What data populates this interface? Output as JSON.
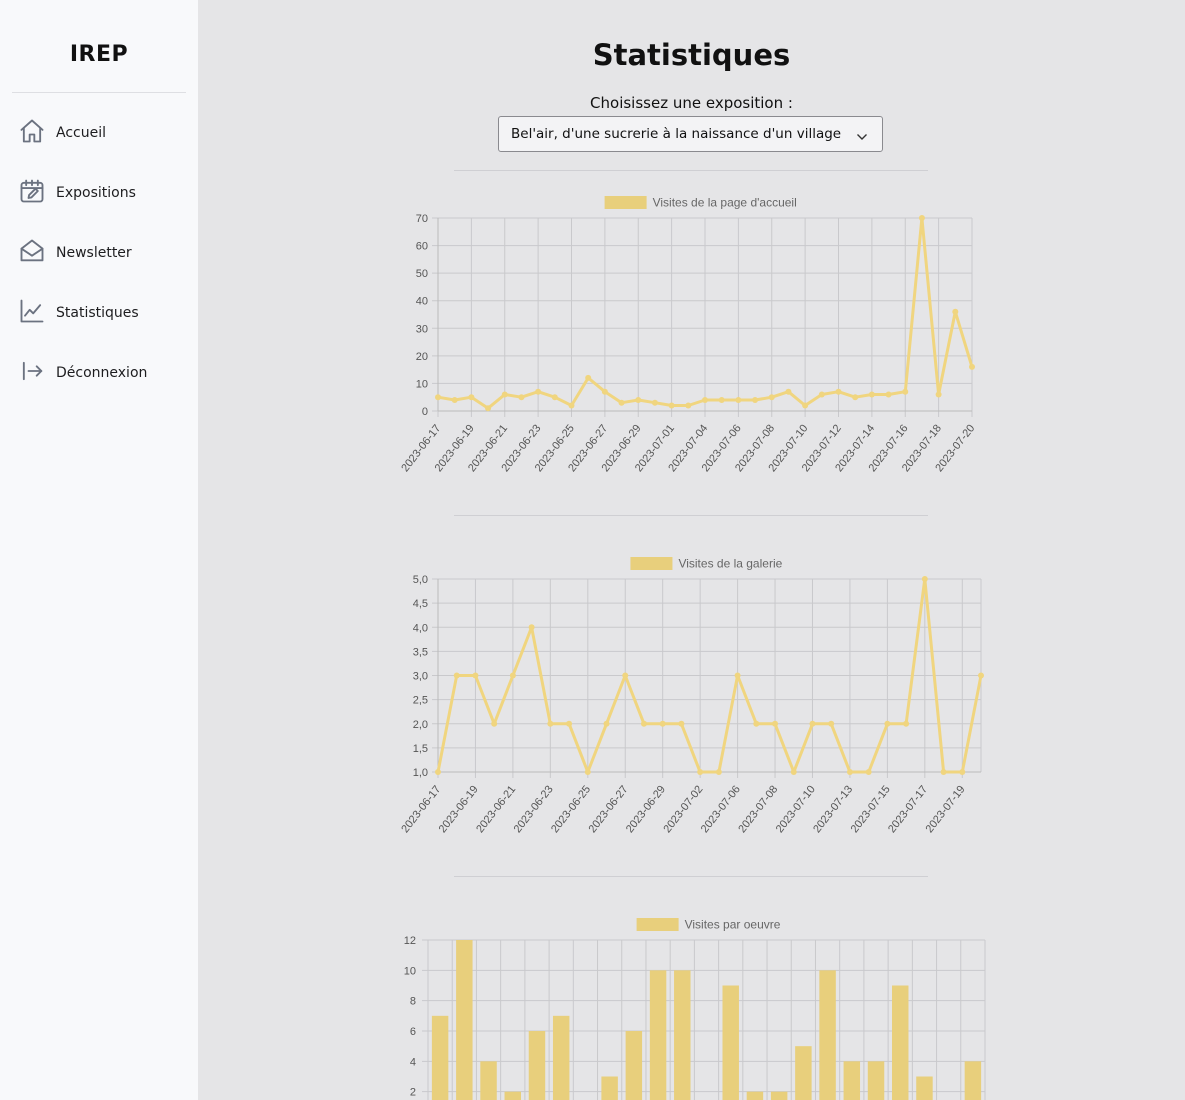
{
  "sidebar": {
    "logo": "IREP",
    "items": [
      {
        "label": "Accueil",
        "icon": "home-icon"
      },
      {
        "label": "Expositions",
        "icon": "calendar-edit-icon"
      },
      {
        "label": "Newsletter",
        "icon": "mail-open-icon"
      },
      {
        "label": "Statistiques",
        "icon": "line-chart-icon"
      },
      {
        "label": "Déconnexion",
        "icon": "logout-icon"
      }
    ]
  },
  "main": {
    "title": "Statistiques",
    "select_label": "Choisissez une exposition :",
    "selected_exposition": "Bel'air, d'une sucrerie à la naissance d'un village"
  },
  "colors": {
    "series_fill": "#e8cf7c",
    "series_line": "#f0d57f",
    "grid": "#c9c9cc",
    "tick_text": "#555555"
  },
  "chart_data": [
    {
      "type": "line",
      "legend": "Visites de la page d'accueil",
      "ylim": [
        0,
        70
      ],
      "yticks": [
        0,
        10,
        20,
        30,
        40,
        50,
        60,
        70
      ],
      "x": [
        "2023-06-17",
        "2023-06-18",
        "2023-06-19",
        "2023-06-20",
        "2023-06-21",
        "2023-06-22",
        "2023-06-23",
        "2023-06-24",
        "2023-06-25",
        "2023-06-26",
        "2023-06-27",
        "2023-06-28",
        "2023-06-29",
        "2023-06-30",
        "2023-07-01",
        "2023-07-02",
        "2023-07-04",
        "2023-07-05",
        "2023-07-06",
        "2023-07-07",
        "2023-07-08",
        "2023-07-09",
        "2023-07-10",
        "2023-07-11",
        "2023-07-12",
        "2023-07-13",
        "2023-07-14",
        "2023-07-15",
        "2023-07-16",
        "2023-07-17",
        "2023-07-18",
        "2023-07-19",
        "2023-07-20"
      ],
      "values": [
        5,
        4,
        5,
        1,
        6,
        5,
        7,
        5,
        2,
        12,
        7,
        3,
        4,
        3,
        2,
        2,
        4,
        4,
        4,
        4,
        5,
        7,
        2,
        6,
        7,
        5,
        6,
        6,
        7,
        70,
        6,
        36,
        16
      ],
      "xtick_labels": [
        "2023-06-17",
        "2023-06-19",
        "2023-06-21",
        "2023-06-23",
        "2023-06-25",
        "2023-06-27",
        "2023-06-29",
        "2023-07-01",
        "2023-07-04",
        "2023-07-06",
        "2023-07-08",
        "2023-07-10",
        "2023-07-12",
        "2023-07-14",
        "2023-07-16",
        "2023-07-18",
        "2023-07-20"
      ],
      "grid": true,
      "legend_position": "top"
    },
    {
      "type": "line",
      "legend": "Visites de la galerie",
      "ylim": [
        1,
        5
      ],
      "yticks": [
        "1,0",
        "1,5",
        "2,0",
        "2,5",
        "3,0",
        "3,5",
        "4,0",
        "4,5",
        "5,0"
      ],
      "x": [
        "2023-06-17",
        "2023-06-18",
        "2023-06-19",
        "2023-06-20",
        "2023-06-21",
        "2023-06-22",
        "2023-06-23",
        "2023-06-24",
        "2023-06-25",
        "2023-06-26",
        "2023-06-27",
        "2023-06-28",
        "2023-06-29",
        "2023-06-30",
        "2023-07-02",
        "2023-07-04",
        "2023-07-06",
        "2023-07-07",
        "2023-07-08",
        "2023-07-09",
        "2023-07-10",
        "2023-07-11",
        "2023-07-13",
        "2023-07-14",
        "2023-07-15",
        "2023-07-16",
        "2023-07-17",
        "2023-07-18",
        "2023-07-19",
        "2023-07-20"
      ],
      "values": [
        1,
        3,
        3,
        2,
        3,
        4,
        2,
        2,
        1,
        2,
        3,
        2,
        2,
        2,
        1,
        1,
        3,
        2,
        2,
        1,
        2,
        2,
        1,
        1,
        2,
        2,
        5,
        1,
        1,
        3
      ],
      "xtick_labels": [
        "2023-06-17",
        "2023-06-19",
        "2023-06-21",
        "2023-06-23",
        "2023-06-25",
        "2023-06-27",
        "2023-06-29",
        "2023-07-02",
        "2023-07-06",
        "2023-07-08",
        "2023-07-10",
        "2023-07-13",
        "2023-07-15",
        "2023-07-17",
        "2023-07-19"
      ],
      "grid": true,
      "legend_position": "top"
    },
    {
      "type": "bar",
      "legend": "Visites par oeuvre",
      "ylim": [
        0,
        12
      ],
      "yticks": [
        2,
        4,
        6,
        8,
        10,
        12
      ],
      "values": [
        7,
        12,
        4,
        2,
        6,
        7,
        0,
        3,
        6,
        10,
        10,
        0,
        9,
        2,
        2,
        5,
        10,
        4,
        4,
        9,
        3,
        0,
        4
      ],
      "grid": true,
      "legend_position": "top"
    }
  ]
}
